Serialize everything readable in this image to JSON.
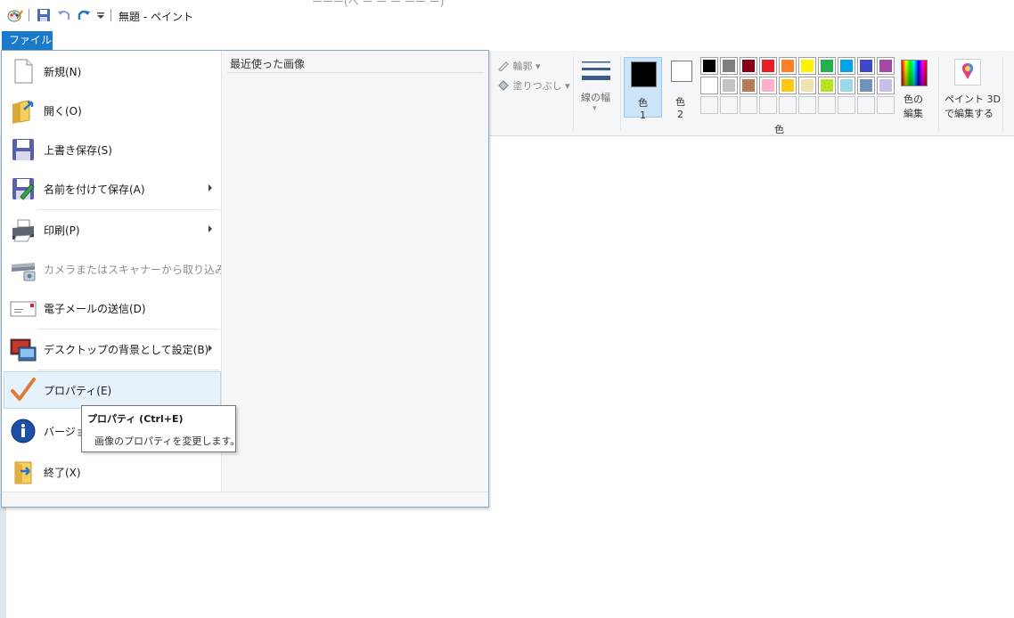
{
  "titlebar": {
    "title": "無題 - ペイント",
    "behind_text": "ーーー(ヘ ー ー ー ーー ー)"
  },
  "file_tab": {
    "label": "ファイル"
  },
  "file_menu": {
    "items": [
      {
        "label": "新規(N)",
        "icon": "new-file-icon"
      },
      {
        "label": "開く(O)",
        "icon": "open-folder-icon"
      },
      {
        "label": "上書き保存(S)",
        "icon": "save-icon"
      },
      {
        "label": "名前を付けて保存(A)",
        "icon": "save-as-icon"
      },
      {
        "label": "印刷(P)",
        "icon": "printer-icon"
      },
      {
        "label": "カメラまたはスキャナーから取り込み(M)",
        "icon": "scanner-icon"
      },
      {
        "label": "電子メールの送信(D)",
        "icon": "email-icon"
      },
      {
        "label": "デスクトップの背景として設定(B)",
        "icon": "desktop-background-icon"
      },
      {
        "label": "プロパティ(E)",
        "icon": "checkmark-icon"
      },
      {
        "label": "バージョン",
        "icon": "info-icon"
      },
      {
        "label": "終了(X)",
        "icon": "exit-icon"
      }
    ],
    "recent_title": "最近使った画像"
  },
  "tooltip": {
    "title": "プロパティ (Ctrl+E)",
    "description": "画像のプロパティを変更します。"
  },
  "ribbon": {
    "outline_label": "輪郭",
    "fill_label": "塗りつぶし",
    "line_width_label": "線の幅",
    "color1_label_top": "色",
    "color1_label_bottom": "1",
    "color2_label_top": "色",
    "color2_label_bottom": "2",
    "colors_group_label": "色",
    "edit_colors_label_top": "色の",
    "edit_colors_label_bottom": "編集",
    "paint3d_label_top": "ペイント 3D",
    "paint3d_label_bottom": "で編集する",
    "palette_row1": [
      "#000000",
      "#7f7f7f",
      "#880015",
      "#ed1c24",
      "#ff7f27",
      "#fff200",
      "#22b14c",
      "#00a2e8",
      "#3f48cc",
      "#a349a4"
    ],
    "palette_row2": [
      "#ffffff",
      "#c3c3c3",
      "#b97a57",
      "#ffaec9",
      "#ffc90e",
      "#efe4b0",
      "#b5e61d",
      "#99d9ea",
      "#7092be",
      "#c8bfe7"
    ]
  }
}
